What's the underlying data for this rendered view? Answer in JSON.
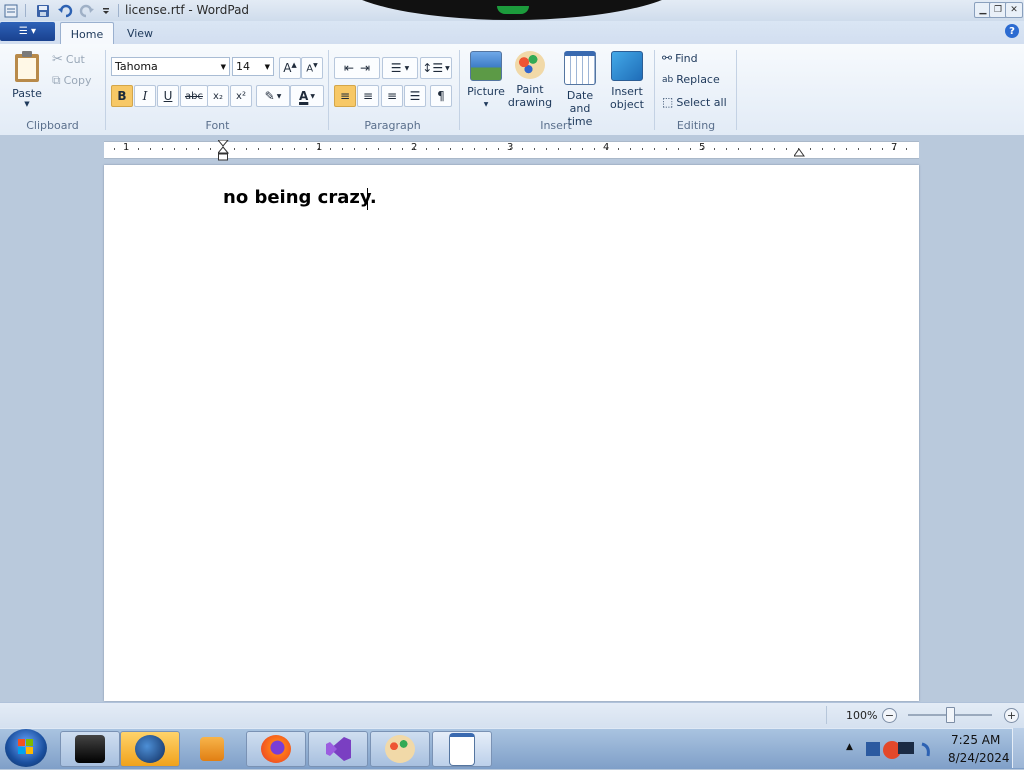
{
  "window": {
    "title": "license.rtf - WordPad"
  },
  "quick_access": {
    "icons": [
      "app-icon",
      "save-icon",
      "undo-icon",
      "redo-icon",
      "customize-icon"
    ]
  },
  "tabs": {
    "home": "Home",
    "view": "View"
  },
  "ribbon": {
    "clipboard": {
      "label": "Clipboard",
      "paste": "Paste",
      "cut": "Cut",
      "copy": "Copy"
    },
    "font": {
      "label": "Font",
      "family": "Tahoma",
      "size": "14",
      "bold": "B",
      "italic": "I",
      "underline": "U",
      "strike": "abc",
      "subscript": "x₂",
      "superscript": "x²",
      "color": "A"
    },
    "paragraph": {
      "label": "Paragraph"
    },
    "insert": {
      "label": "Insert",
      "picture": "Picture",
      "paint_1": "Paint",
      "paint_2": "drawing",
      "datetime_1": "Date and",
      "datetime_2": "time",
      "object_1": "Insert",
      "object_2": "object"
    },
    "editing": {
      "label": "Editing",
      "find": "Find",
      "replace": "Replace",
      "select_all": "Select all"
    }
  },
  "ruler": {
    "numbers": [
      "1",
      "1",
      "2",
      "3",
      "4",
      "5",
      "7"
    ]
  },
  "document": {
    "text": "no being crazy."
  },
  "status": {
    "zoom": "100%"
  },
  "taskbar": {
    "time": "7:25 AM",
    "date": "8/24/2024"
  },
  "colors": {
    "accent": "#f5c663",
    "title_bar": "#dbe6f4",
    "ribbon": "#eef3fa",
    "taskbar": "#94b2d6"
  }
}
